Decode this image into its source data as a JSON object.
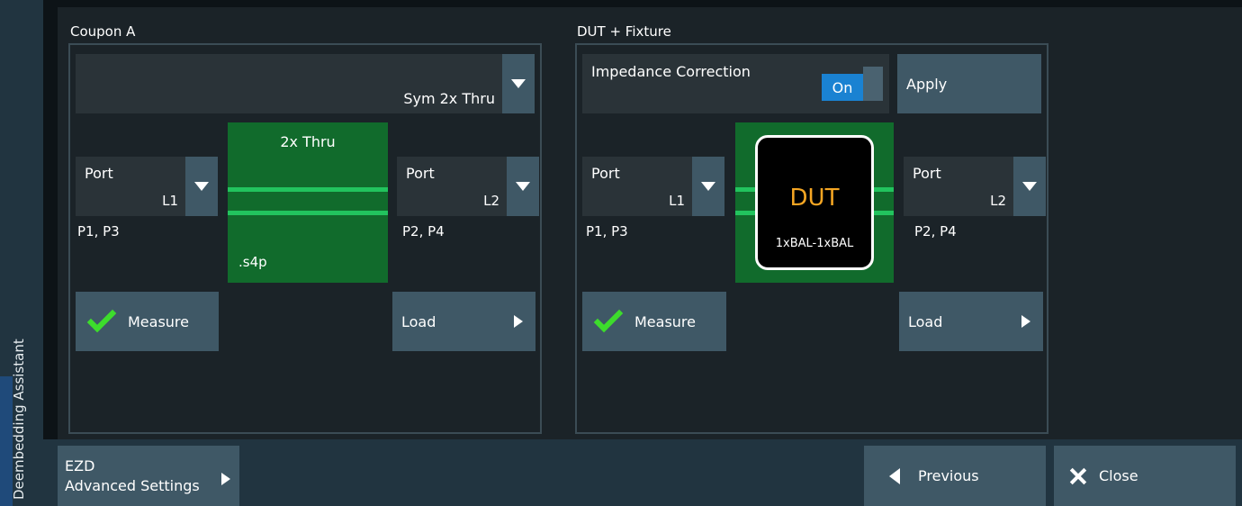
{
  "side_tab": {
    "label": "Deembedding Assistant"
  },
  "coupon": {
    "title": "Coupon A",
    "method_select": "Sym 2x Thru",
    "port_left": {
      "label": "Port",
      "value": "L1",
      "ports": "P1, P3"
    },
    "port_right": {
      "label": "Port",
      "value": "L2",
      "ports": "P2, P4"
    },
    "thru_title": "2x Thru",
    "thru_file": ".s4p",
    "measure_label": "Measure",
    "load_label": "Load"
  },
  "dut_fixture": {
    "title": "DUT + Fixture",
    "impedance_label": "Impedance Correction",
    "impedance_state": "On",
    "apply_label": "Apply",
    "port_left": {
      "label": "Port",
      "value": "L1",
      "ports": "P1, P3"
    },
    "port_right": {
      "label": "Port",
      "value": "L2",
      "ports": "P2, P4"
    },
    "dut_label": "DUT",
    "dut_config": "1xBAL-1xBAL",
    "measure_label": "Measure",
    "load_label": "Load"
  },
  "footer": {
    "ezd_line1": "EZD",
    "ezd_line2": "Advanced Settings",
    "previous_label": "Previous",
    "close_label": "Close"
  },
  "colors": {
    "accent_blue": "#1a82d2",
    "check_green": "#3ddc2c",
    "block_green": "#116b2c",
    "dut_orange": "#f5a623"
  }
}
